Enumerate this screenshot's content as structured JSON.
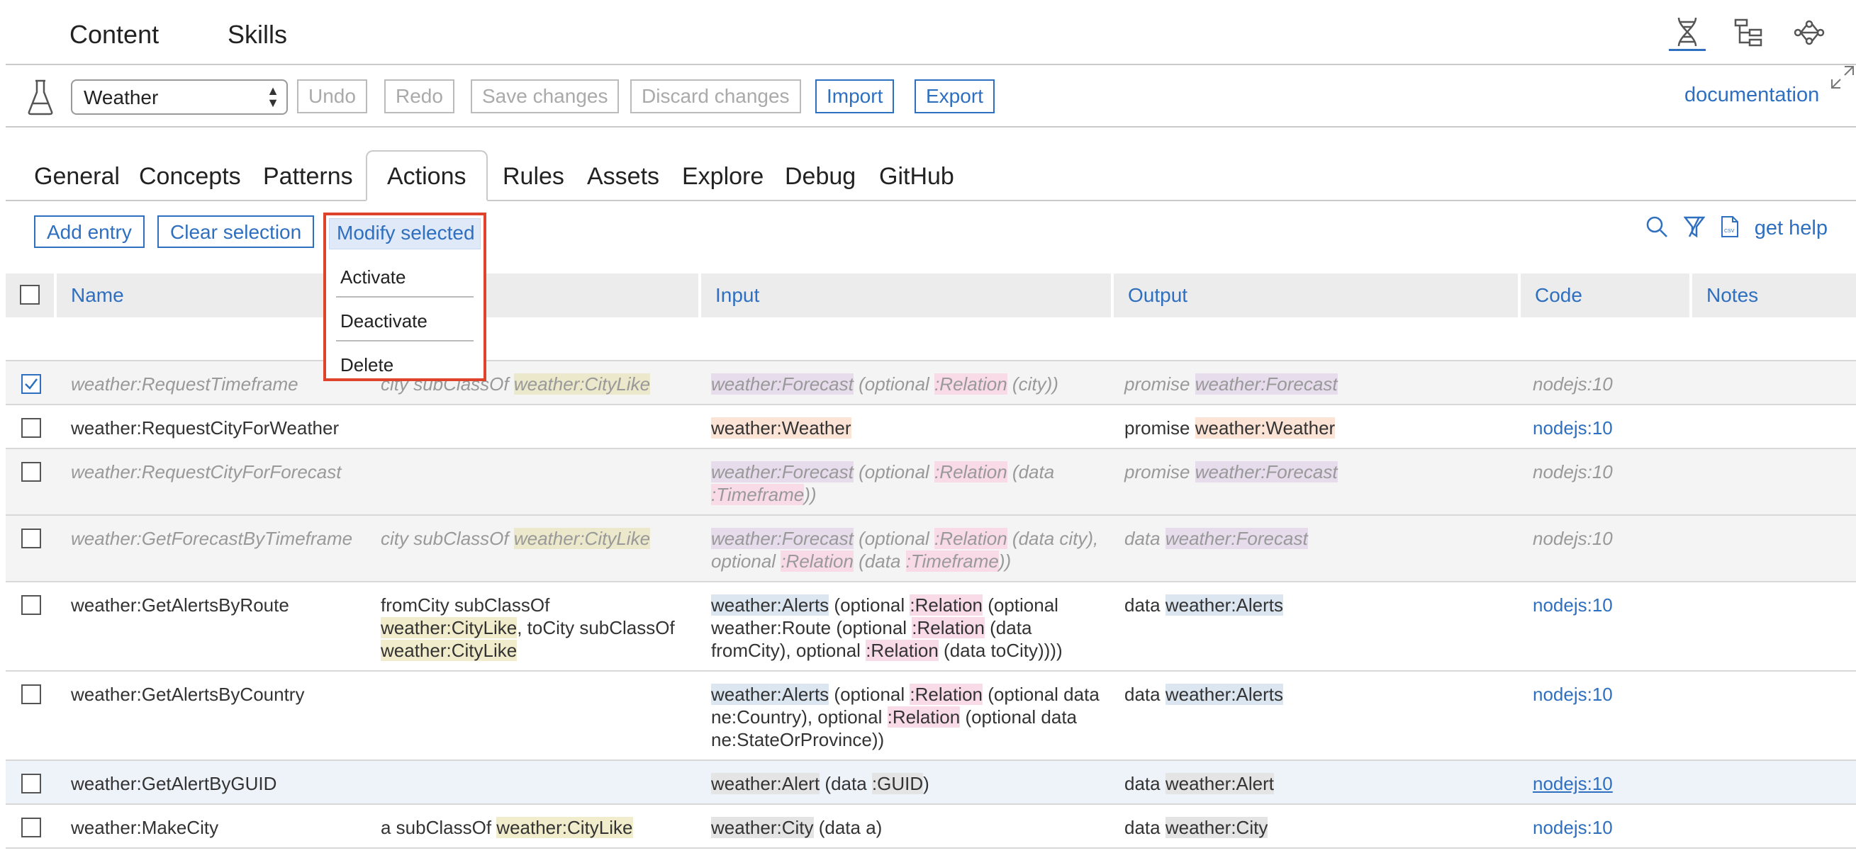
{
  "topnav": {
    "tabs": [
      "Content",
      "Skills"
    ],
    "icons": [
      "dna-icon",
      "tree-icon",
      "network-icon"
    ]
  },
  "toolbar": {
    "selected_skill": "Weather",
    "undo": "Undo",
    "redo": "Redo",
    "save": "Save changes",
    "discard": "Discard changes",
    "import": "Import",
    "export": "Export",
    "documentation": "documentation"
  },
  "subtabs": [
    "General",
    "Concepts",
    "Patterns",
    "Actions",
    "Rules",
    "Assets",
    "Explore",
    "Debug",
    "GitHub"
  ],
  "actions": {
    "add_entry": "Add entry",
    "clear_selection": "Clear selection",
    "modify_selected": "Modify selected",
    "menu": [
      "Activate",
      "Deactivate",
      "Delete"
    ],
    "get_help": "get help"
  },
  "table": {
    "headers": {
      "name": "Name",
      "input": "Input",
      "output": "Output",
      "code": "Code",
      "notes": "Notes"
    },
    "rows": [
      {
        "name": "weather:RequestTimeframe",
        "cond": {
          "a": "city subClassOf ",
          "b": "weather:CityLike"
        },
        "input": {
          "a": "weather:Forecast",
          "b": " (optional ",
          "c": ":Relation",
          "d": " (city))"
        },
        "output": {
          "a": "promise ",
          "b": "weather:Forecast"
        },
        "code": "nodejs:10"
      },
      {
        "name": "weather:RequestCityForWeather",
        "input": {
          "a": "weather:Weather"
        },
        "output": {
          "a": "promise ",
          "b": "weather:Weather"
        },
        "code": "nodejs:10"
      },
      {
        "name": "weather:RequestCityForForecast",
        "input": {
          "a": "weather:Forecast",
          "b": " (optional ",
          "c": ":Relation",
          "d": " (data ",
          "e": ":Timeframe",
          "f": "))"
        },
        "output": {
          "a": "promise ",
          "b": "weather:Forecast"
        },
        "code": "nodejs:10"
      },
      {
        "name": "weather:GetForecastByTimeframe",
        "cond": {
          "a": "city subClassOf ",
          "b": "weather:CityLike"
        },
        "input": {
          "a": "weather:Forecast",
          "b": " (optional ",
          "c": ":Relation",
          "d": " (data city), optional ",
          "e": ":Relation",
          "f": " (data ",
          "g": ":Timeframe",
          "h": "))"
        },
        "output": {
          "a": "data ",
          "b": "weather:Forecast"
        },
        "code": "nodejs:10"
      },
      {
        "name": "weather:GetAlertsByRoute",
        "cond": {
          "a": "fromCity subClassOf",
          "b": "weather:CityLike",
          "c": ", toCity subClassOf",
          "d": "weather:CityLike"
        },
        "input": {
          "a": "weather:Alerts",
          "b": " (optional ",
          "c": ":Relation",
          "d": " (optional",
          "e": "weather:Route (optional ",
          "f": ":Relation",
          "g": " (data",
          "h": "fromCity), optional ",
          "i": ":Relation",
          "j": " (data toCity))))"
        },
        "output": {
          "a": "data ",
          "b": "weather:Alerts"
        },
        "code": "nodejs:10"
      },
      {
        "name": "weather:GetAlertsByCountry",
        "input": {
          "a": "weather:Alerts",
          "b": " (optional ",
          "c": ":Relation",
          "d": " (optional data",
          "e": "ne:Country",
          "f": "), optional ",
          "g": ":Relation",
          "h": " (optional data",
          "i": "ne:StateOrProvince",
          "j": "))"
        },
        "output": {
          "a": "data ",
          "b": "weather:Alerts"
        },
        "code": "nodejs:10"
      },
      {
        "name": "weather:GetAlertByGUID",
        "input": {
          "a": "weather:Alert",
          "b": " (data ",
          "c": ":GUID",
          "d": ")"
        },
        "output": {
          "a": "data ",
          "b": "weather:Alert"
        },
        "code": "nodejs:10"
      },
      {
        "name": "weather:MakeCity",
        "cond": {
          "a": "a subClassOf ",
          "b": "weather:CityLike"
        },
        "input": {
          "a": "weather:City",
          "b": " (data a)"
        },
        "output": {
          "a": "data ",
          "b": "weather:City"
        },
        "code": "nodejs:10"
      }
    ]
  }
}
